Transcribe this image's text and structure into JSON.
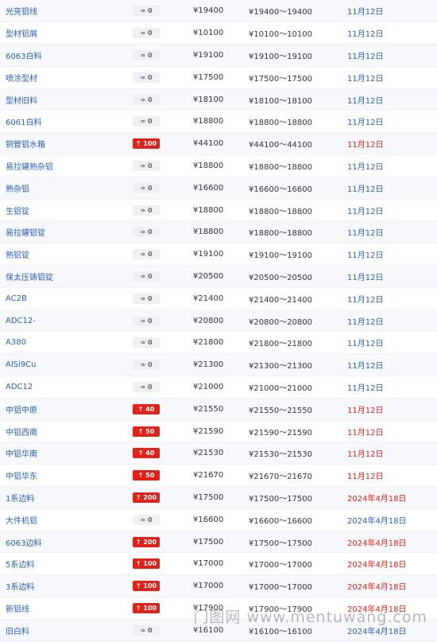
{
  "currency_symbol": "¥",
  "separator": "～",
  "rows": [
    {
      "name": "光亮铝线",
      "direction": "flat",
      "change": "0",
      "price": "19400",
      "low": "19400",
      "high": "19400",
      "date": "11月12日",
      "date_color": "blue"
    },
    {
      "name": "型材铝屑",
      "direction": "flat",
      "change": "0",
      "price": "10100",
      "low": "10100",
      "high": "10100",
      "date": "11月12日",
      "date_color": "blue"
    },
    {
      "name": "6063白料",
      "direction": "flat",
      "change": "0",
      "price": "19100",
      "low": "19100",
      "high": "19100",
      "date": "11月12日",
      "date_color": "blue"
    },
    {
      "name": "喷涂型材",
      "direction": "flat",
      "change": "0",
      "price": "17500",
      "low": "17500",
      "high": "17500",
      "date": "11月12日",
      "date_color": "blue"
    },
    {
      "name": "型材旧料",
      "direction": "flat",
      "change": "0",
      "price": "18100",
      "low": "18100",
      "high": "18100",
      "date": "11月12日",
      "date_color": "blue"
    },
    {
      "name": "6061白料",
      "direction": "flat",
      "change": "0",
      "price": "18800",
      "low": "18800",
      "high": "18800",
      "date": "11月12日",
      "date_color": "blue"
    },
    {
      "name": "铜管铝水箱",
      "direction": "up",
      "change": "100",
      "price": "44100",
      "low": "44100",
      "high": "44100",
      "date": "11月12日",
      "date_color": "red"
    },
    {
      "name": "易拉罐熟杂铝",
      "direction": "flat",
      "change": "0",
      "price": "18800",
      "low": "18800",
      "high": "18800",
      "date": "11月12日",
      "date_color": "blue"
    },
    {
      "name": "熟杂铝",
      "direction": "flat",
      "change": "0",
      "price": "16600",
      "low": "16600",
      "high": "16600",
      "date": "11月12日",
      "date_color": "blue"
    },
    {
      "name": "生铝锭",
      "direction": "flat",
      "change": "0",
      "price": "18800",
      "low": "18800",
      "high": "18800",
      "date": "11月12日",
      "date_color": "blue"
    },
    {
      "name": "易拉罐铝锭",
      "direction": "flat",
      "change": "0",
      "price": "18800",
      "low": "18800",
      "high": "18800",
      "date": "11月12日",
      "date_color": "blue"
    },
    {
      "name": "熟铝锭",
      "direction": "flat",
      "change": "0",
      "price": "19100",
      "low": "19100",
      "high": "19100",
      "date": "11月12日",
      "date_color": "blue"
    },
    {
      "name": "保太压铸铝锭",
      "direction": "flat",
      "change": "0",
      "price": "20500",
      "low": "20500",
      "high": "20500",
      "date": "11月12日",
      "date_color": "blue"
    },
    {
      "name": "AC2B",
      "direction": "flat",
      "change": "0",
      "price": "21400",
      "low": "21400",
      "high": "21400",
      "date": "11月12日",
      "date_color": "blue"
    },
    {
      "name": "ADC12-",
      "direction": "flat",
      "change": "0",
      "price": "20800",
      "low": "20800",
      "high": "20800",
      "date": "11月12日",
      "date_color": "blue"
    },
    {
      "name": "A380",
      "direction": "flat",
      "change": "0",
      "price": "21800",
      "low": "21800",
      "high": "21800",
      "date": "11月12日",
      "date_color": "blue"
    },
    {
      "name": "AlSi9Cu",
      "direction": "flat",
      "change": "0",
      "price": "21300",
      "low": "21300",
      "high": "21300",
      "date": "11月12日",
      "date_color": "blue"
    },
    {
      "name": "ADC12",
      "direction": "flat",
      "change": "0",
      "price": "21000",
      "low": "21000",
      "high": "21000",
      "date": "11月12日",
      "date_color": "blue"
    },
    {
      "name": "中铝中原",
      "direction": "up",
      "change": "40",
      "price": "21550",
      "low": "21550",
      "high": "21550",
      "date": "11月12日",
      "date_color": "red"
    },
    {
      "name": "中铝西南",
      "direction": "up",
      "change": "50",
      "price": "21590",
      "low": "21590",
      "high": "21590",
      "date": "11月12日",
      "date_color": "red"
    },
    {
      "name": "中铝华南",
      "direction": "up",
      "change": "40",
      "price": "21530",
      "low": "21530",
      "high": "21530",
      "date": "11月12日",
      "date_color": "red"
    },
    {
      "name": "中铝华东",
      "direction": "up",
      "change": "50",
      "price": "21670",
      "low": "21670",
      "high": "21670",
      "date": "11月12日",
      "date_color": "red"
    },
    {
      "name": "1系边料",
      "direction": "up",
      "change": "200",
      "price": "17500",
      "low": "17500",
      "high": "17500",
      "date": "2024年4月18日",
      "date_color": "red"
    },
    {
      "name": "大件机铝",
      "direction": "flat",
      "change": "0",
      "price": "16600",
      "low": "16600",
      "high": "16600",
      "date": "2024年4月18日",
      "date_color": "blue"
    },
    {
      "name": "6063边料",
      "direction": "up",
      "change": "200",
      "price": "17500",
      "low": "17500",
      "high": "17500",
      "date": "2024年4月18日",
      "date_color": "red"
    },
    {
      "name": "5系边料",
      "direction": "up",
      "change": "100",
      "price": "17000",
      "low": "17000",
      "high": "17000",
      "date": "2024年4月18日",
      "date_color": "red"
    },
    {
      "name": "3系边料",
      "direction": "up",
      "change": "100",
      "price": "17000",
      "low": "17000",
      "high": "17000",
      "date": "2024年4月18日",
      "date_color": "red"
    },
    {
      "name": "新铝线",
      "direction": "up",
      "change": "100",
      "price": "17900",
      "low": "17900",
      "high": "17900",
      "date": "2024年4月18日",
      "date_color": "red"
    },
    {
      "name": "旧白料",
      "direction": "flat",
      "change": "0",
      "price": "16100",
      "low": "16100",
      "high": "16100",
      "date": "2024年4月18日",
      "date_color": "blue"
    }
  ],
  "footer_watermark": "门图网 www.mentuwang.com",
  "colors": {
    "up": "#e32119",
    "link": "#2a5fb3",
    "flat_badge": "#eef0f4"
  }
}
